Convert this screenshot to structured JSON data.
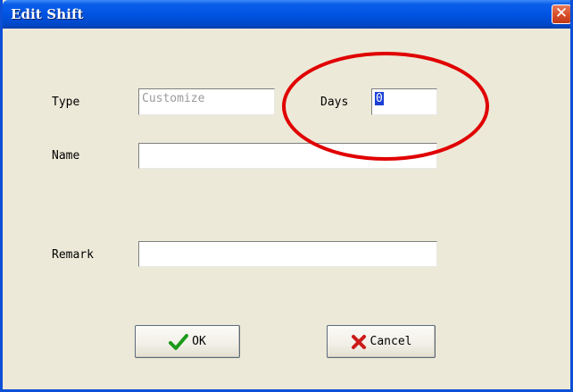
{
  "window": {
    "title": "Edit Shift",
    "close_glyph": "✕"
  },
  "form": {
    "type_label": "Type",
    "type_value": "Customize",
    "days_label": "Days",
    "days_value": "0",
    "name_label": "Name",
    "name_value": "",
    "remark_label": "Remark",
    "remark_value": ""
  },
  "buttons": {
    "ok_label": "OK",
    "ok_icon": "checkmark-icon",
    "cancel_label": "Cancel",
    "cancel_icon": "x-mark-icon"
  },
  "colors": {
    "titlebar": "#0054e3",
    "dialog_bg": "#ece9d8",
    "annotation": "#e00000",
    "ok_icon": "#1a9a1a",
    "cancel_icon": "#cc1a1a"
  }
}
